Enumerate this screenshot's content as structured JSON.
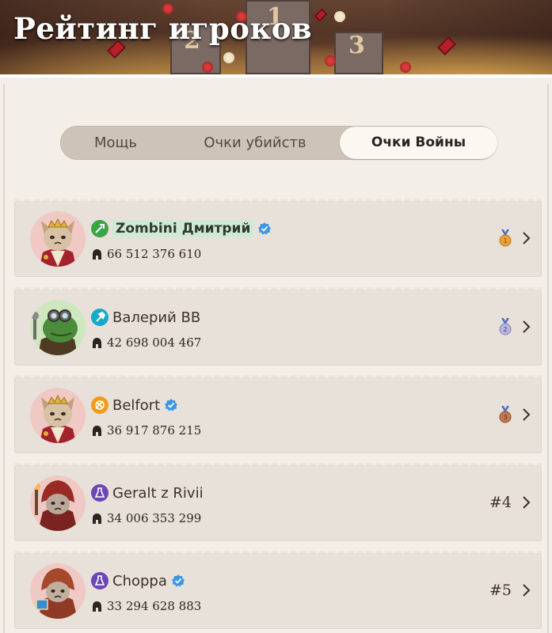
{
  "header": {
    "title": "Рейтинг игроков",
    "podium_numbers": [
      "1",
      "2",
      "3"
    ]
  },
  "tabs": [
    {
      "label": "Мощь",
      "active": false
    },
    {
      "label": "Очки убийств",
      "active": false
    },
    {
      "label": "Очки Войны",
      "active": true
    }
  ],
  "players": [
    {
      "name": "Zombini Дмитрий",
      "score": "66 512 376 610",
      "rank": "1",
      "class_icon": "sword-icon",
      "class_color": "#3aa446",
      "verified": true,
      "highlight": true,
      "avatar": "cat-king"
    },
    {
      "name": "Валерий BB",
      "score": "42 698 004 467",
      "rank": "2",
      "class_icon": "hammer-icon",
      "class_color": "#17a9c9",
      "verified": false,
      "highlight": false,
      "avatar": "frog-engineer"
    },
    {
      "name": "Belfort",
      "score": "36 917 876 215",
      "rank": "3",
      "class_icon": "scroll-icon",
      "class_color": "#f39a1d",
      "verified": true,
      "highlight": false,
      "avatar": "cat-king"
    },
    {
      "name": "Geralt z Rivii",
      "score": "34 006 353 299",
      "rank": "#4",
      "class_icon": "flask-icon",
      "class_color": "#6d46b5",
      "verified": false,
      "highlight": false,
      "avatar": "cat-mage"
    },
    {
      "name": "Choppa",
      "score": "33 294 628 883",
      "rank": "#5",
      "class_icon": "flask-icon",
      "class_color": "#6d46b5",
      "verified": true,
      "highlight": false,
      "avatar": "cat-mage"
    }
  ],
  "medal_colors": {
    "gold": "#e8a236",
    "silver": "#b9b4dd",
    "bronze": "#c07a55",
    "ribbon": "#4b6bc6"
  },
  "verified_color": "#3b96e8"
}
